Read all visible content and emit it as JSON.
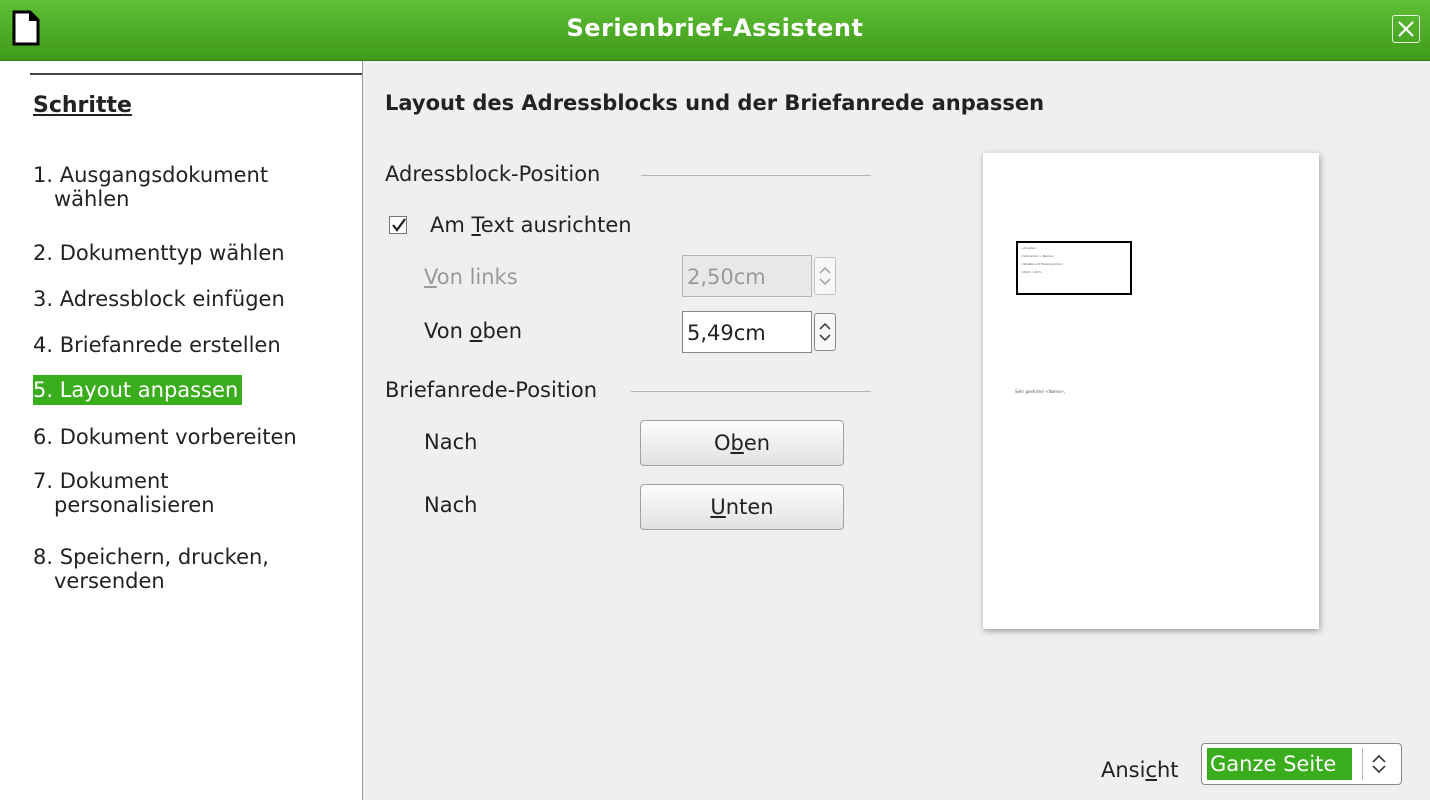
{
  "window": {
    "title": "Serienbrief-Assistent",
    "app_icon": "document-icon",
    "close_icon": "close-icon"
  },
  "sidebar": {
    "heading": "Schritte",
    "steps": [
      {
        "num": "1.",
        "line1": "Ausgangsdokument",
        "line2": "wählen",
        "active": false
      },
      {
        "num": "2.",
        "line1": "Dokumenttyp wählen",
        "active": false
      },
      {
        "num": "3.",
        "line1": "Adressblock einfügen",
        "active": false
      },
      {
        "num": "4.",
        "line1": "Briefanrede erstellen",
        "active": false
      },
      {
        "num": "5.",
        "line1": "Layout anpassen",
        "active": true
      },
      {
        "num": "6.",
        "line1": "Dokument vorbereiten",
        "active": false
      },
      {
        "num": "7.",
        "line1": "Dokument",
        "line2": "personalisieren",
        "active": false
      },
      {
        "num": "8.",
        "line1": "Speichern, drucken,",
        "line2": "versenden",
        "active": false
      }
    ]
  },
  "main": {
    "heading": "Layout des Adressblocks und der Briefanrede anpassen",
    "address_group": {
      "label": "Adressblock-Position",
      "align_checkbox": {
        "pre": "Am ",
        "mnemonic": "T",
        "post": "ext ausrichten",
        "checked": true
      },
      "from_left": {
        "mnemonic": "V",
        "rest": "on links",
        "value": "2,50cm",
        "enabled": false
      },
      "from_top": {
        "pre": "Von ",
        "mnemonic": "o",
        "post": "ben",
        "value": "5,49cm",
        "enabled": true
      }
    },
    "salutation_group": {
      "label": "Briefanrede-Position",
      "row1_label": "Nach",
      "up_button": {
        "pre": "O",
        "mnemonic": "b",
        "post": "en"
      },
      "row2_label": "Nach",
      "down_button": {
        "mnemonic": "U",
        "post": "nten"
      }
    },
    "preview": {
      "address_lines": [
        "<Anrede>",
        "<Vorname> <Name>",
        "<Straße und Hausnummer>",
        "<PLZ> <Ort>"
      ],
      "salutation": "Sehr geehrte/r <Name>,"
    },
    "view": {
      "label_pre": "Ansi",
      "label_mnemonic": "c",
      "label_post": "ht",
      "value": "Ganze Seite"
    }
  }
}
